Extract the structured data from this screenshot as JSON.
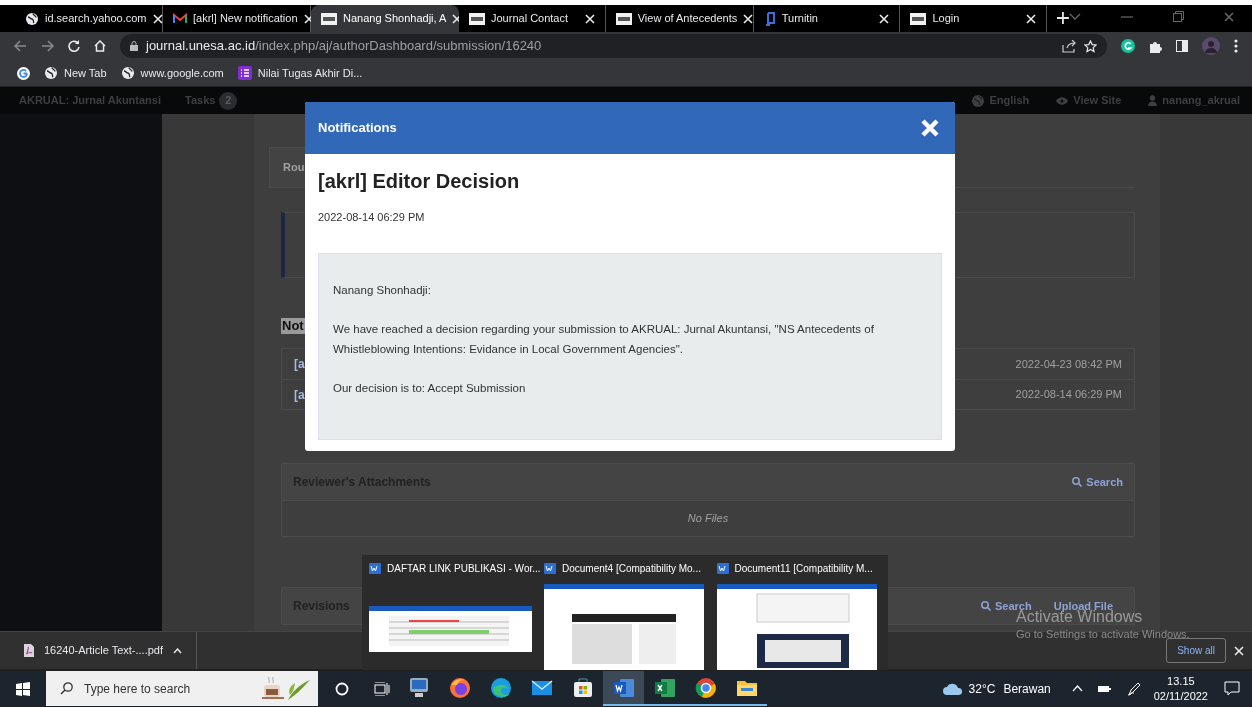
{
  "browser": {
    "tabs": [
      {
        "title": "id.search.yahoo.com",
        "kind": "globe",
        "selected": false
      },
      {
        "title": "[akrl] New notification",
        "kind": "mail",
        "selected": false
      },
      {
        "title": "Nanang Shonhadji, A",
        "kind": "journal",
        "selected": true
      },
      {
        "title": "Journal Contact",
        "kind": "journal",
        "selected": false
      },
      {
        "title": "View of Antecedents",
        "kind": "journal",
        "selected": false
      },
      {
        "title": "Turnitin",
        "kind": "turnitin",
        "selected": false
      },
      {
        "title": "Login",
        "kind": "journal",
        "selected": false
      }
    ],
    "address": {
      "host": "journal.unesa.ac.id",
      "path": "/index.php/aj/authorDashboard/submission/16240"
    },
    "bookmarks": [
      {
        "label": "New Tab",
        "kind": "globe"
      },
      {
        "label": "www.google.com",
        "kind": "globe"
      },
      {
        "label": "Nilai Tugas Akhir Di...",
        "kind": "list"
      }
    ]
  },
  "site_header": {
    "journal": "AKRUAL: Jurnal Akuntansi",
    "tasks_label": "Tasks",
    "tasks_count": "2",
    "links": [
      {
        "label": "English",
        "kind": "globe"
      },
      {
        "label": "View Site",
        "kind": "eye"
      },
      {
        "label": "nanang_akrual",
        "kind": "user"
      }
    ]
  },
  "page": {
    "tab_fragment": "Rou",
    "notifications_heading_fragment": "Not",
    "notification_rows": [
      {
        "title": "[a",
        "time": "2022-04-23 08:42 PM"
      },
      {
        "title": "[a",
        "time": "2022-08-14 06:29 PM"
      }
    ],
    "reviewer_attachments": {
      "title": "Reviewer's Attachments",
      "search": "Search",
      "empty": "No Files"
    },
    "revisions": {
      "title": "Revisions",
      "search": "Search",
      "upload": "Upload File"
    }
  },
  "modal": {
    "header": "Notifications",
    "title": "[akrl] Editor Decision",
    "date": "2022-08-14 06:29 PM",
    "paragraphs": [
      "Nanang Shonhadji:",
      "We have reached a decision regarding your submission to AKRUAL: Jurnal Akuntansi, \"NS Antecedents of Whistleblowing Intentions: Evidance in Local Government Agencies\".",
      "Our decision is to: Accept Submission"
    ]
  },
  "taskbar_previews": [
    {
      "title": "DAFTAR LINK PUBLIKASI - Wor...",
      "kind": "spreadsheet"
    },
    {
      "title": "Document4 [Compatibility Mo...",
      "kind": "document"
    },
    {
      "title": "Document11 [Compatibility M...",
      "kind": "screenshot"
    }
  ],
  "download_bar": {
    "file": "16240-Article Text-....pdf",
    "show_all": "Show all"
  },
  "activation_notice": {
    "title": "Activate Windows",
    "subtitle": "Go to Settings to activate Windows."
  },
  "taskbar": {
    "search_placeholder": "Type here to search",
    "apps": [
      {
        "kind": "computer",
        "running": false,
        "active": false
      },
      {
        "kind": "firefox",
        "running": false,
        "active": false
      },
      {
        "kind": "edge",
        "running": false,
        "active": false
      },
      {
        "kind": "mail",
        "running": false,
        "active": false
      },
      {
        "kind": "store",
        "running": false,
        "active": false
      },
      {
        "kind": "word",
        "running": true,
        "active": true
      },
      {
        "kind": "excel",
        "running": true,
        "active": false
      },
      {
        "kind": "chrome",
        "running": true,
        "active": false
      },
      {
        "kind": "explorer",
        "running": true,
        "active": false
      }
    ],
    "temperature": "32°C",
    "weather": "Berawan",
    "time": "13.15",
    "date": "02/11/2022"
  }
}
